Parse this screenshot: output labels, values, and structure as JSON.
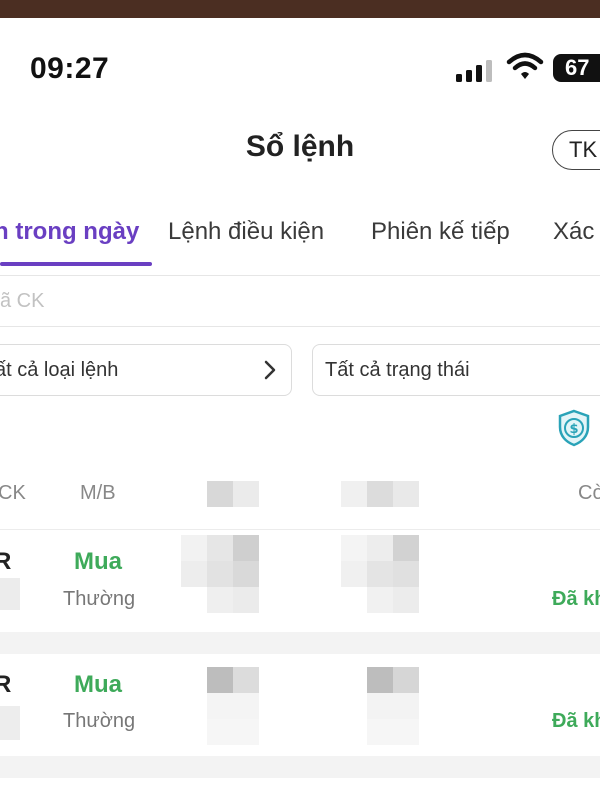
{
  "status_bar": {
    "time": "09:27",
    "battery": "67"
  },
  "header": {
    "title": "Sổ lệnh",
    "account_button": "TK"
  },
  "tabs": [
    {
      "label": "n trong ngày",
      "active": true
    },
    {
      "label": "Lệnh điều kiện",
      "active": false
    },
    {
      "label": "Phiên kế tiếp",
      "active": false
    },
    {
      "label": "Xác",
      "active": false
    }
  ],
  "search": {
    "placeholder": "ã CK",
    "value": ""
  },
  "filters": {
    "order_type": "ất cả loại lệnh",
    "status": "Tất cả trạng thái"
  },
  "table": {
    "headers": {
      "symbol": "CK",
      "side": "M/B",
      "remaining": "Cò"
    },
    "rows": [
      {
        "symbol": "R",
        "side": "Mua",
        "order_type": "Thường",
        "status": "Đã kh"
      },
      {
        "symbol": "R",
        "side": "Mua",
        "order_type": "Thường",
        "status": "Đã kh"
      }
    ]
  },
  "colors": {
    "accent": "#6a3fc2",
    "buy": "#3eaa5a",
    "shield": "#2aa3b8"
  },
  "icons": {
    "account_shield": "shield-dollar-icon",
    "filter_next": "chevron-right-icon"
  }
}
